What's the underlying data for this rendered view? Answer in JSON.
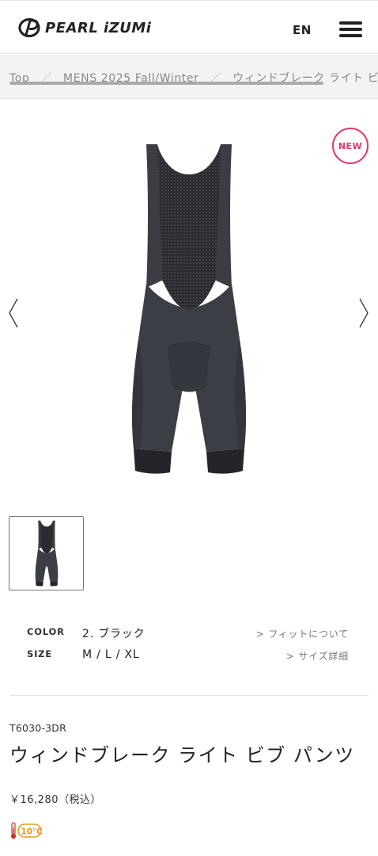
{
  "header": {
    "brand": "PEARL iZUMi",
    "language": "EN",
    "menu_icon": "hamburger-menu-icon"
  },
  "breadcrumb": {
    "items": [
      "Top",
      "MENS 2025 Fall/Winter",
      "ウィンドブレーク ライト ビ"
    ],
    "separator": "／"
  },
  "gallery": {
    "badge": "NEW",
    "prev_icon": "chevron-left-icon",
    "next_icon": "chevron-right-icon",
    "image_alt": "bib-pants-product-image"
  },
  "specs": {
    "color_label": "COLOR",
    "color_value": "2. ブラック",
    "fit_link": "> フィットについて",
    "size_label": "SIZE",
    "size_value": "M / L / XL",
    "size_link": "> サイズ詳細"
  },
  "product": {
    "sku": "T6030-3DR",
    "title": "ウィンドブレーク ライト ビブ パンツ",
    "price": "￥16,280（税込）",
    "temperature_badge": "10℃",
    "temperature_icon": "thermometer-icon"
  },
  "colors": {
    "accent_badge": "#e23a6d",
    "temp_badge": "#e8962a",
    "text_dark": "#222222",
    "breadcrumb_bg": "#f3f3f3"
  }
}
